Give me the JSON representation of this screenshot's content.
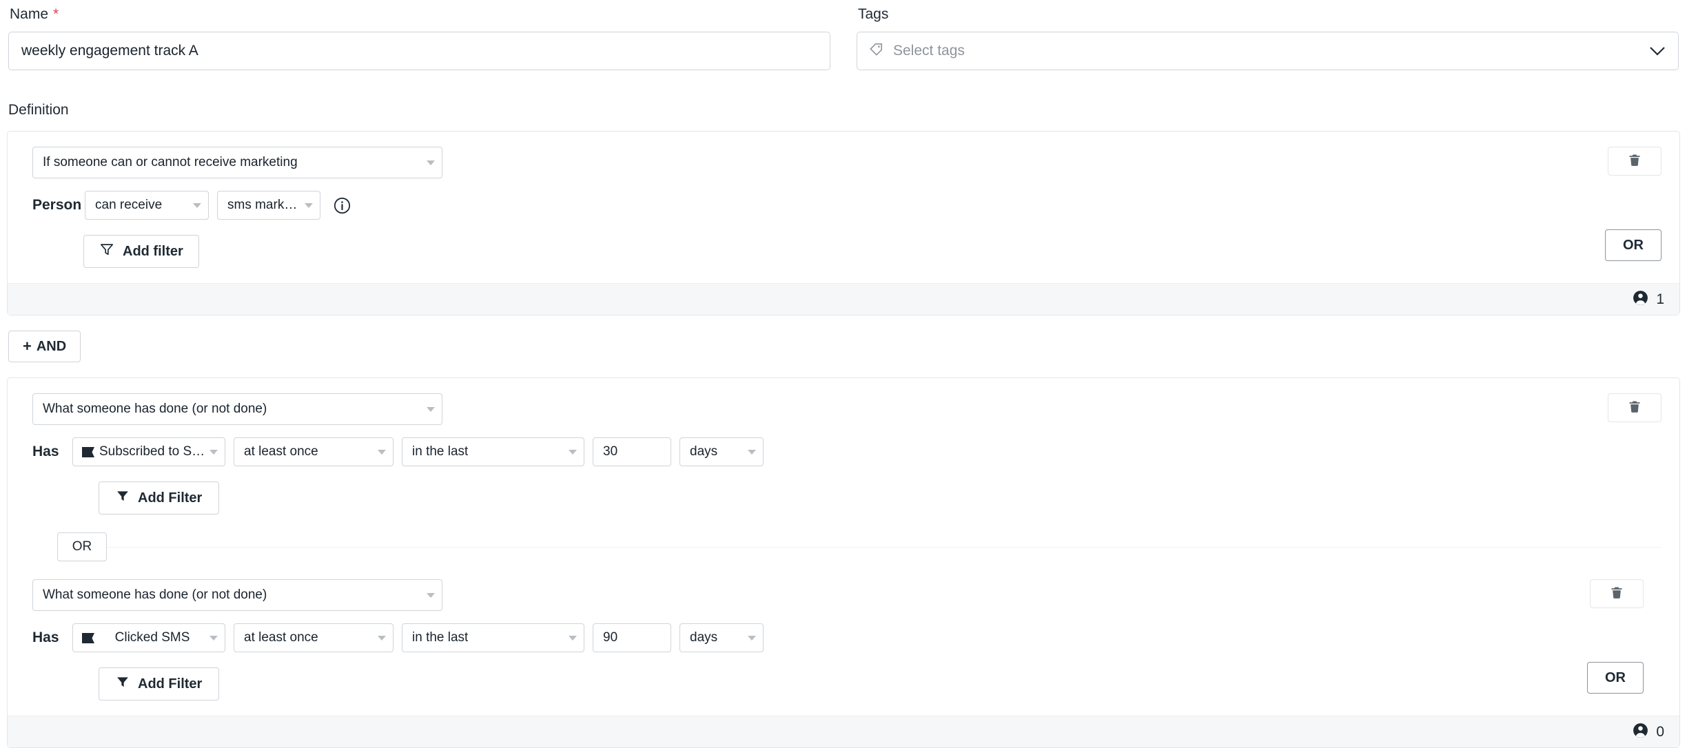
{
  "name_field": {
    "label": "Name",
    "required_marker": "*",
    "value": "weekly engagement track A"
  },
  "tags_field": {
    "label": "Tags",
    "placeholder": "Select tags",
    "icon": "tag-icon",
    "chevron": "chevron-down-icon"
  },
  "definition": {
    "label": "Definition",
    "and_button": {
      "plus": "+",
      "label": "AND"
    },
    "blocks": [
      {
        "type_select": "If someone can or cannot receive marketing",
        "row_label": "Person",
        "selects": [
          {
            "name": "receive-state-select",
            "value": "can receive"
          },
          {
            "name": "channel-select",
            "value": "sms marketing"
          }
        ],
        "info_icon": "info-icon",
        "add_filter_label": "Add filter",
        "add_filter_icon": "filter-outline-icon",
        "or_label": "OR",
        "delete_icon": "trash-icon",
        "footer": {
          "icon": "person-icon",
          "count": "1"
        }
      }
    ],
    "event_block": {
      "or_separator_label": "OR",
      "delete_icon": "trash-icon",
      "or_label": "OR",
      "footer": {
        "icon": "person-icon",
        "count": "0"
      },
      "rows": [
        {
          "type_select": "What someone has done (or not done)",
          "row_label": "Has",
          "event_icon": "event-flag-icon",
          "event": "Subscribed to SMS Mar...",
          "frequency": "at least once",
          "timeframe": "in the last",
          "amount": "30",
          "unit": "days",
          "add_filter_label": "Add Filter",
          "add_filter_icon": "filter-solid-icon"
        },
        {
          "type_select": "What someone has done (or not done)",
          "row_label": "Has",
          "event_icon": "event-flag-icon",
          "event": "Clicked SMS",
          "frequency": "at least once",
          "timeframe": "in the last",
          "amount": "90",
          "unit": "days",
          "add_filter_label": "Add Filter",
          "add_filter_icon": "filter-solid-icon"
        }
      ]
    }
  },
  "colors": {
    "border": "#cfd4d9",
    "required": "#d6455e",
    "footer_bg": "#f6f7f8",
    "text": "#1f2933",
    "placeholder": "#8d949c"
  }
}
